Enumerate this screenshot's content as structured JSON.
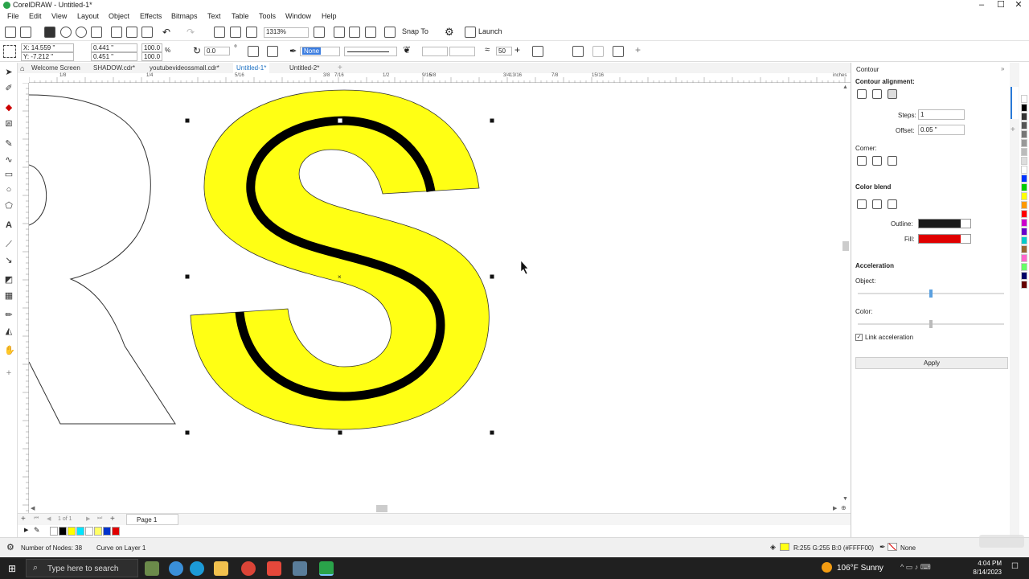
{
  "app": {
    "title": "CorelDRAW - Untitled-1*",
    "window_controls": [
      "–",
      "☐",
      "✕"
    ]
  },
  "menu": [
    "File",
    "Edit",
    "View",
    "Layout",
    "Object",
    "Effects",
    "Bitmaps",
    "Text",
    "Table",
    "Tools",
    "Window",
    "Help"
  ],
  "toolbar": {
    "zoom": "1313%",
    "snap_to": "Snap To",
    "launch": "Launch"
  },
  "propbar": {
    "x": "X: 14.559 \"",
    "y": "Y: -7.212 \"",
    "w": "0.441 \"",
    "h": "0.451 \"",
    "scale_w": "100.0",
    "scale_h": "100.0",
    "pct": "%",
    "angle": "0.0",
    "outline_none": "None",
    "nodes_value": "50"
  },
  "doctabs": [
    "Welcome Screen",
    "SHADOW.cdr*",
    "youtubevideossmall.cdr*",
    "Untitled-1*",
    "Untitled-2*"
  ],
  "active_tab_index": 3,
  "ruler": {
    "labels": [
      "1/8",
      "1/4",
      "5/16",
      "3/8",
      "7/16",
      "1/2",
      "9/16",
      "5/8",
      "11/16",
      "3/4",
      "13/16",
      "7/8",
      "15/16"
    ],
    "unit": "inches"
  },
  "pagebar": {
    "page_count": "1 of 1",
    "page_tab": "Page 1"
  },
  "status": {
    "nodes": "Number of Nodes: 38",
    "layer": "Curve on Layer 1",
    "fill_info": "R:255 G:255 B:0 (#FFFF00)",
    "outline_info": "None"
  },
  "docker": {
    "title": "Contour",
    "alignment_label": "Contour alignment:",
    "steps_label": "Steps:",
    "steps_value": "1",
    "offset_label": "Offset:",
    "offset_value": "0.05 \"",
    "corner_label": "Corner:",
    "color_blend_label": "Color blend",
    "outline_label": "Outline:",
    "fill_label": "Fill:",
    "acceleration_label": "Acceleration",
    "object_label": "Object:",
    "color_label": "Color:",
    "link_label": "Link acceleration",
    "apply_label": "Apply",
    "outline_color": "#1a1a1a",
    "fill_color": "#e00000",
    "object_accel": 0.5,
    "color_accel": 0.5,
    "link_checked": true
  },
  "palette_colors": [
    "#ffffff",
    "#000000",
    "#ffff00",
    "#00e5ff",
    "#ffffff",
    "#ffff66",
    "#0033cc",
    "#e00000"
  ],
  "right_palette": [
    "#ffffff",
    "#000000",
    "#333333",
    "#555555",
    "#777777",
    "#999999",
    "#bbbbbb",
    "#dddddd",
    "#ffffff",
    "#0033ff",
    "#00cc00",
    "#ffff00",
    "#ff9900",
    "#ff0000",
    "#cc00cc",
    "#6600cc",
    "#00cccc",
    "#996633",
    "#ff66cc",
    "#66ff66",
    "#000066",
    "#660000"
  ],
  "canvas": {
    "letter_fill": "#ffff14",
    "contour_color": "#000000"
  },
  "taskbar": {
    "search_placeholder": "Type here to search",
    "weather": "106°F  Sunny",
    "time": "4:04 PM",
    "date": "8/14/2023"
  }
}
